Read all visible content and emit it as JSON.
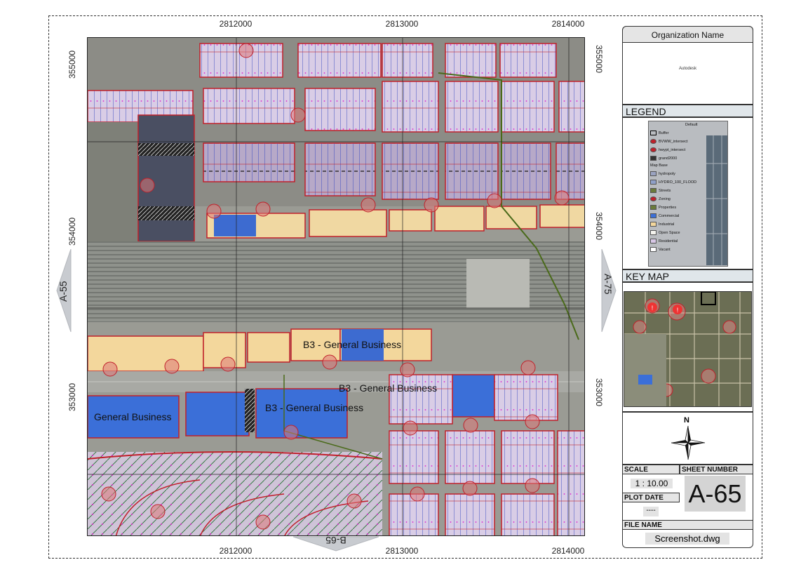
{
  "map": {
    "coords_top": [
      "2812000",
      "2813000",
      "2814000"
    ],
    "coords_bottom": [
      "2812000",
      "2813000",
      "2814000"
    ],
    "coords_left": [
      "355000",
      "354000",
      "353000"
    ],
    "coords_right": [
      "355000",
      "354000",
      "353000"
    ],
    "neighbors": {
      "left": "A-55",
      "right": "A-75",
      "bottom": "B-65"
    },
    "zone_labels": [
      "B3 - General Business",
      "B3 - General Business",
      "B3 - General Business",
      "General Business"
    ],
    "colors": {
      "parcel_outline": "#c0202a",
      "lot_lines": "#2030c8",
      "commercial": "#f5d9a0",
      "industrial": "#3b6fd8",
      "residential": "#d8c8e6",
      "rail": "#555555"
    }
  },
  "title_block": {
    "organization_name": "Organization Name",
    "organization_logo_text": "Autodesk",
    "legend_title": "LEGEND",
    "legend_items": [
      "Default",
      "Buffer",
      "BVWW_intersect",
      "hwypt_intersect",
      "grand2000",
      "Map Base",
      "hydropoly",
      "HYDRO_100_FLOOD",
      "Streets",
      "Zoning",
      "Properties",
      "Commercial",
      "Industrial",
      "Open Space",
      "Residential",
      "Vacant"
    ],
    "key_map_title": "KEY MAP",
    "north_label": "N",
    "scale_label": "SCALE",
    "scale_value": "1 : 10.00",
    "sheet_number_label": "SHEET NUMBER",
    "sheet_number": "A-65",
    "plot_date_label": "PLOT DATE",
    "plot_date_value": "----",
    "file_name_label": "FILE NAME",
    "file_name_value": "Screenshot.dwg"
  }
}
